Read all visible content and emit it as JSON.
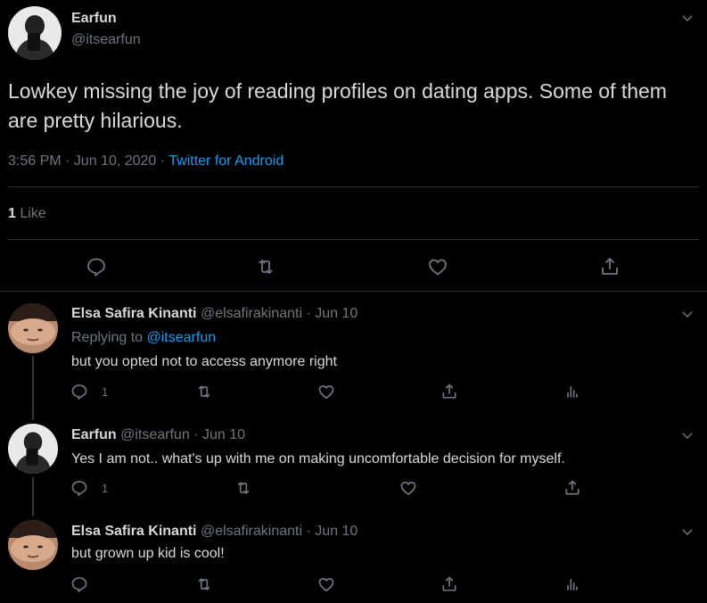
{
  "main_tweet": {
    "name": "Earfun",
    "handle": "@itsearfun",
    "text": "Lowkey missing the joy of reading profiles on dating apps. Some of them are pretty hilarious.",
    "time": "3:56 PM · Jun 10, 2020 · ",
    "source": "Twitter for Android",
    "likes_count": "1",
    "likes_label": " Like"
  },
  "replies": [
    {
      "name": "Elsa Safira Kinanti",
      "handle_date": " @elsafirakinanti · Jun 10",
      "replying_prefix": "Replying to ",
      "replying_to": "@itsearfun",
      "text": "but you opted not to access anymore right",
      "reply_count": "1"
    },
    {
      "name": "Earfun",
      "handle_date": " @itsearfun · Jun 10",
      "text": "Yes I am not.. what's up with me on making uncomfortable decision for myself.",
      "reply_count": "1"
    },
    {
      "name": "Elsa Safira Kinanti",
      "handle_date": " @elsafirakinanti · Jun 10",
      "text": "but grown up kid is cool!"
    }
  ],
  "icons": [
    "chevron-down-icon",
    "reply-icon",
    "retweet-icon",
    "like-icon",
    "share-icon",
    "analytics-icon"
  ],
  "colors": {
    "background": "#000000",
    "text": "#d9d9d9",
    "muted": "#6e767d",
    "link": "#1d9bf0",
    "divider": "#2f3336"
  }
}
